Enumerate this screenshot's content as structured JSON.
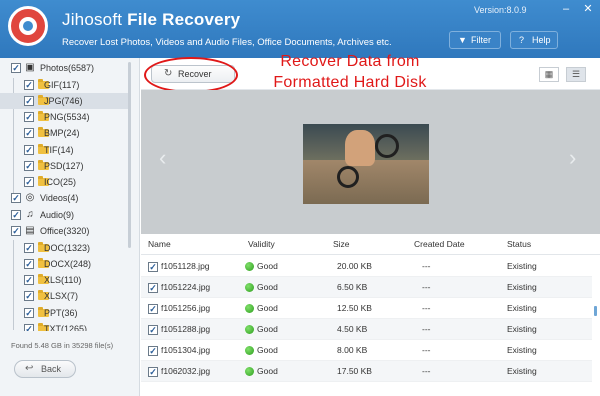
{
  "app": {
    "title_light": "Jihosoft",
    "title_bold": "File Recovery",
    "subtitle": "Recover Lost Photos, Videos and Audio Files, Office Documents, Archives etc.",
    "version": "Version:8.0.9",
    "minimize": "–",
    "close": "✕",
    "filter_label": "Filter",
    "help_label": "Help"
  },
  "sidebar": {
    "photos": "Photos(6587)",
    "gif": "GIF(117)",
    "jpg": "JPG(746)",
    "png": "PNG(5534)",
    "bmp": "BMP(24)",
    "tif": "TIF(14)",
    "psd": "PSD(127)",
    "ico": "ICO(25)",
    "videos": "Videos(4)",
    "audio": "Audio(9)",
    "office": "Office(3320)",
    "doc": "DOC(1323)",
    "docx": "DOCX(248)",
    "xls": "XLS(110)",
    "xlsx": "XLSX(7)",
    "ppt": "PPT(36)",
    "txt": "TXT(1265)",
    "found": "Found 5.48 GB in 35298 file(s)",
    "back_label": "Back"
  },
  "toolbar": {
    "recover_label": "Recover",
    "annotation_line1": "Recover Data from",
    "annotation_line2": "Formatted Hard Disk"
  },
  "table": {
    "headers": {
      "name": "Name",
      "validity": "Validity",
      "size": "Size",
      "created": "Created Date",
      "status": "Status"
    },
    "rows": [
      {
        "name": "f1051128.jpg",
        "validity": "Good",
        "size": "20.00 KB",
        "created": "---",
        "status": "Existing"
      },
      {
        "name": "f1051224.jpg",
        "validity": "Good",
        "size": "6.50 KB",
        "created": "---",
        "status": "Existing"
      },
      {
        "name": "f1051256.jpg",
        "validity": "Good",
        "size": "12.50 KB",
        "created": "---",
        "status": "Existing"
      },
      {
        "name": "f1051288.jpg",
        "validity": "Good",
        "size": "4.50 KB",
        "created": "---",
        "status": "Existing"
      },
      {
        "name": "f1051304.jpg",
        "validity": "Good",
        "size": "8.00 KB",
        "created": "---",
        "status": "Existing"
      },
      {
        "name": "f1062032.jpg",
        "validity": "Good",
        "size": "17.50 KB",
        "created": "---",
        "status": "Existing"
      }
    ]
  },
  "icons": {
    "check": "✓",
    "filter_icon": "▼",
    "help_icon": "?",
    "recover_icon": "↻",
    "back_icon": "↩",
    "grid_icon": "▦",
    "list_icon": "☰",
    "prev_icon": "‹",
    "next_icon": "›",
    "videos_icon": "◎",
    "audio_icon": "♫",
    "office_icon": "▤",
    "photos_icon": "▣"
  },
  "colors": {
    "header": "#3a84c8",
    "annotation": "#e01818",
    "good": "#3aa82a"
  }
}
